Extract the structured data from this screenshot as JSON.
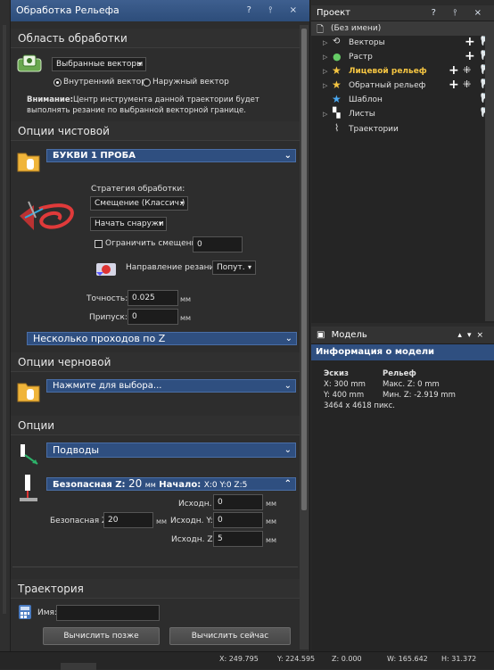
{
  "left_panel": {
    "title": "Обработка Рельефа",
    "title_buttons": "? ⫯ ×",
    "area": {
      "heading": "Область обработки",
      "selection": "Выбранные векторы",
      "radio_inner": "Внутренний вектор",
      "radio_outer": "Наружный вектор",
      "note_bold": "Внимание:",
      "note_text": "Центр инструмента данной траектории будет выполнять резание по выбранной векторной границе."
    },
    "finish": {
      "heading": "Опции чистовой",
      "tool": "БУКВИ 1 ПРОБА",
      "strategy_label": "Стратегия обработки:",
      "strategy_value": "Смещение (Классич.)",
      "start_value": "Начать снаружи",
      "limit_label": "Ограничить смещение",
      "limit_value": "0",
      "direction_label": "Направление резания:",
      "direction_value": "Попут.",
      "tolerance_label": "Точность:",
      "tolerance_value": "0.025",
      "allowance_label": "Припуск:",
      "allowance_value": "0",
      "unit_mm": "мм",
      "multipass": "Несколько проходов по Z"
    },
    "rough": {
      "heading": "Опции черновой",
      "tool": "Нажмите для выбора..."
    },
    "options": {
      "heading": "Опции",
      "leads": "Подводы",
      "safez_bar_label": "Безопасная Z:",
      "safez_bar_value": "20",
      "safez_bar_unit": "мм",
      "start_label": "Начало:",
      "start_value": "X:0 Y:0 Z:5",
      "home_x_label": "Исходн. X:",
      "home_x_value": "0",
      "home_y_label": "Исходн. Y:",
      "home_y_value": "0",
      "home_z_label": "Исходн. Z:",
      "home_z_value": "5",
      "safez_label": "Безопасная Z:",
      "safez_value": "20",
      "unit_mm": "мм"
    },
    "toolpath": {
      "heading": "Траектория",
      "name_label": "Имя:",
      "name_value": "",
      "calc_later": "Вычислить позже",
      "calc_now": "Вычислить сейчас"
    }
  },
  "project_panel": {
    "title": "Проект",
    "title_buttons": "? ⫯ ×",
    "root": "(Без имени)",
    "items": [
      {
        "label": "Векторы",
        "icon": "vectors-icon"
      },
      {
        "label": "Растр",
        "icon": "raster-icon"
      },
      {
        "label": "Лицевой рельеф",
        "icon": "star-icon"
      },
      {
        "label": "Обратный рельеф",
        "icon": "star-icon"
      },
      {
        "label": "Шаблон",
        "icon": "star-blue-icon"
      },
      {
        "label": "Листы",
        "icon": "sheets-icon"
      },
      {
        "label": "Траектории",
        "icon": "toolpaths-icon"
      }
    ],
    "active_color": "#f5c542"
  },
  "model_panel": {
    "tab": "Модель",
    "title": "Информация о модели",
    "sketch_head": "Эскиз",
    "relief_head": "Рельеф",
    "x_line": "X: 300 mm",
    "y_line": "Y: 400 mm",
    "pixels": "3464 x 4618 пикс.",
    "max_z": "Макс. Z: 0 mm",
    "min_z": "Мин. Z: -2.919 mm"
  },
  "status": {
    "x": "X: 249.795",
    "y": "Y: 224.595",
    "z": "Z: 0.000",
    "w": "W: 165.642",
    "h": "H: 31.372"
  }
}
